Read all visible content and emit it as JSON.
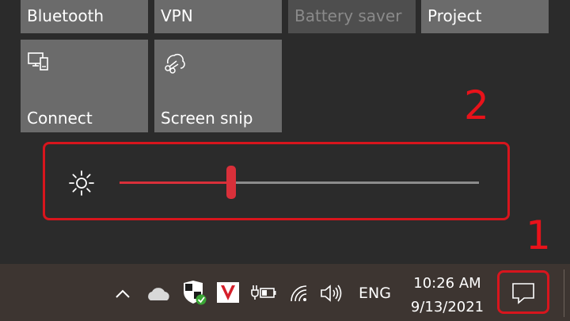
{
  "quick_actions": {
    "tiles": [
      {
        "label": "Bluetooth",
        "enabled": true
      },
      {
        "label": "VPN",
        "enabled": true
      },
      {
        "label": "Battery saver",
        "enabled": false
      },
      {
        "label": "Project",
        "enabled": true
      },
      {
        "label": "Connect",
        "icon": "connect-icon",
        "enabled": true
      },
      {
        "label": "Screen snip",
        "icon": "screen-snip-icon",
        "enabled": true
      }
    ]
  },
  "brightness": {
    "icon": "brightness-sun-icon",
    "value_fraction": 0.31,
    "accent_color": "#d9303a"
  },
  "annotations": {
    "step1": "1",
    "step2": "2",
    "color": "#d8151d"
  },
  "taskbar": {
    "icons": [
      "chevron-up-icon",
      "onedrive-cloud-icon",
      "windows-security-shield-icon",
      "antivirus-v-icon",
      "power-battery-icon",
      "wifi-icon",
      "volume-icon"
    ],
    "language": "ENG",
    "time": "10:26 AM",
    "date": "9/13/2021",
    "notification_icon": "action-center-icon"
  }
}
